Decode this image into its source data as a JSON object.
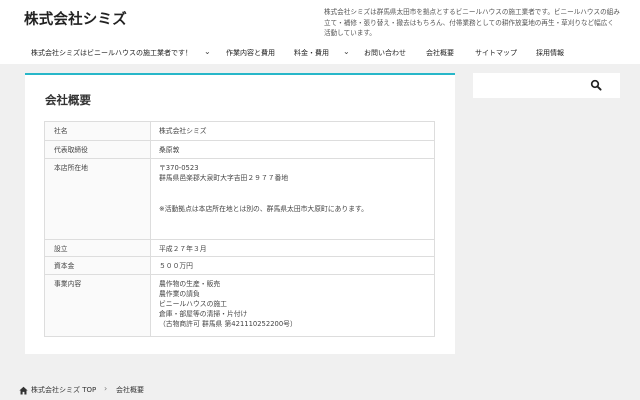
{
  "header": {
    "site_title": "株式会社シミズ",
    "site_description": "株式会社シミズは群馬県太田市を拠点とするビニールハウスの施工業者です。ビニールハウスの組み立て・補修・張り替え・撤去はもちろん、付帯業務としての耕作放棄地の再生・草刈りなど幅広く活動しています。"
  },
  "nav": {
    "items": [
      {
        "label": "株式会社シミズはビニールハウスの施工業者です！",
        "has_submenu": true
      },
      {
        "label": "作業内容と費用",
        "has_submenu": false
      },
      {
        "label": "料金・費用",
        "has_submenu": true
      },
      {
        "label": "お問い合わせ",
        "has_submenu": false
      },
      {
        "label": "会社概要",
        "has_submenu": false
      },
      {
        "label": "サイトマップ",
        "has_submenu": false
      },
      {
        "label": "採用情報",
        "has_submenu": false
      }
    ],
    "submenu_chevron": "⌄"
  },
  "main": {
    "heading": "会社概要",
    "rows": [
      {
        "label": "社名",
        "lines": [
          "株式会社シミズ"
        ]
      },
      {
        "label": "代表取締役",
        "lines": [
          "桑原敦"
        ]
      },
      {
        "label": "本店所在地",
        "lines": [
          "〒370-0523",
          "群馬県邑楽郡大泉町大字吉田２９７７番地",
          "",
          "※活動拠点は本店所在地とは別の、群馬県太田市大原町にあります。"
        ]
      },
      {
        "label": "設立",
        "lines": [
          "平成２７年３月"
        ]
      },
      {
        "label": "資本金",
        "lines": [
          "５００万円"
        ]
      },
      {
        "label": "事業内容",
        "lines": [
          "農作物の生産・販売",
          "農作業の請負",
          "ビニールハウスの施工",
          "倉庫・部屋等の清掃・片付け",
          "（古物商許可 群馬県 第421110252200号）"
        ]
      }
    ]
  },
  "sidebar": {
    "search_placeholder": "",
    "search_icon": "search-icon"
  },
  "breadcrumb": {
    "home_icon": "home-icon",
    "home_label": "株式会社シミズ TOP",
    "separator": "›",
    "current": "会社概要"
  },
  "colors": {
    "accent": "#27b7c9",
    "background": "#f0f0f0"
  }
}
